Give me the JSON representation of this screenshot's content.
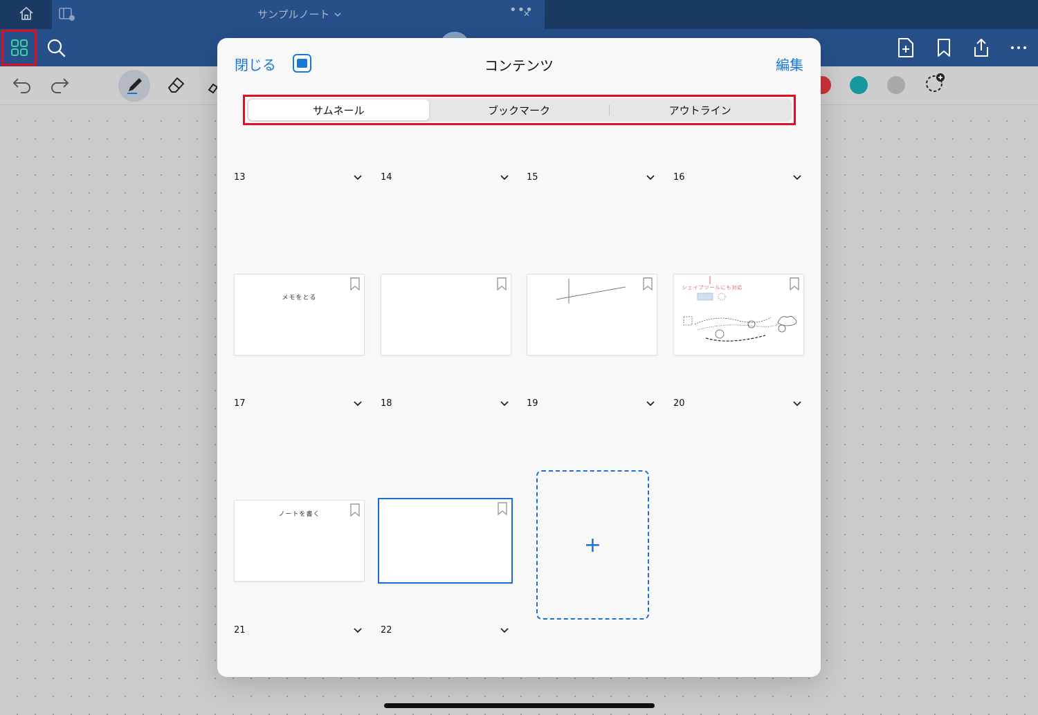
{
  "window": {
    "tab_title": "サンプルノート",
    "tab_more": "•••"
  },
  "modal": {
    "close_label": "閉じる",
    "title": "コンテンツ",
    "edit_label": "編集",
    "segments": [
      "サムネール",
      "ブックマーク",
      "アウトライン"
    ],
    "active_segment": "サムネール"
  },
  "pages": [
    {
      "number": "13"
    },
    {
      "number": "14"
    },
    {
      "number": "15"
    },
    {
      "number": "16"
    },
    {
      "number": "17",
      "thumb_text": "メモをとる"
    },
    {
      "number": "18"
    },
    {
      "number": "19"
    },
    {
      "number": "20",
      "thumb_text": "シェイプツールにも対応"
    },
    {
      "number": "21",
      "thumb_text": "ノートを書く"
    },
    {
      "number": "22",
      "selected": true
    }
  ],
  "add_page_label": "+",
  "colors": {
    "accent": "#1a78d6",
    "highlight": "#e0101e",
    "navbar": "#27508a",
    "tabbar": "#1b3a63",
    "swatches": [
      "#d0313a",
      "#17979f",
      "#a9a9a9"
    ]
  }
}
